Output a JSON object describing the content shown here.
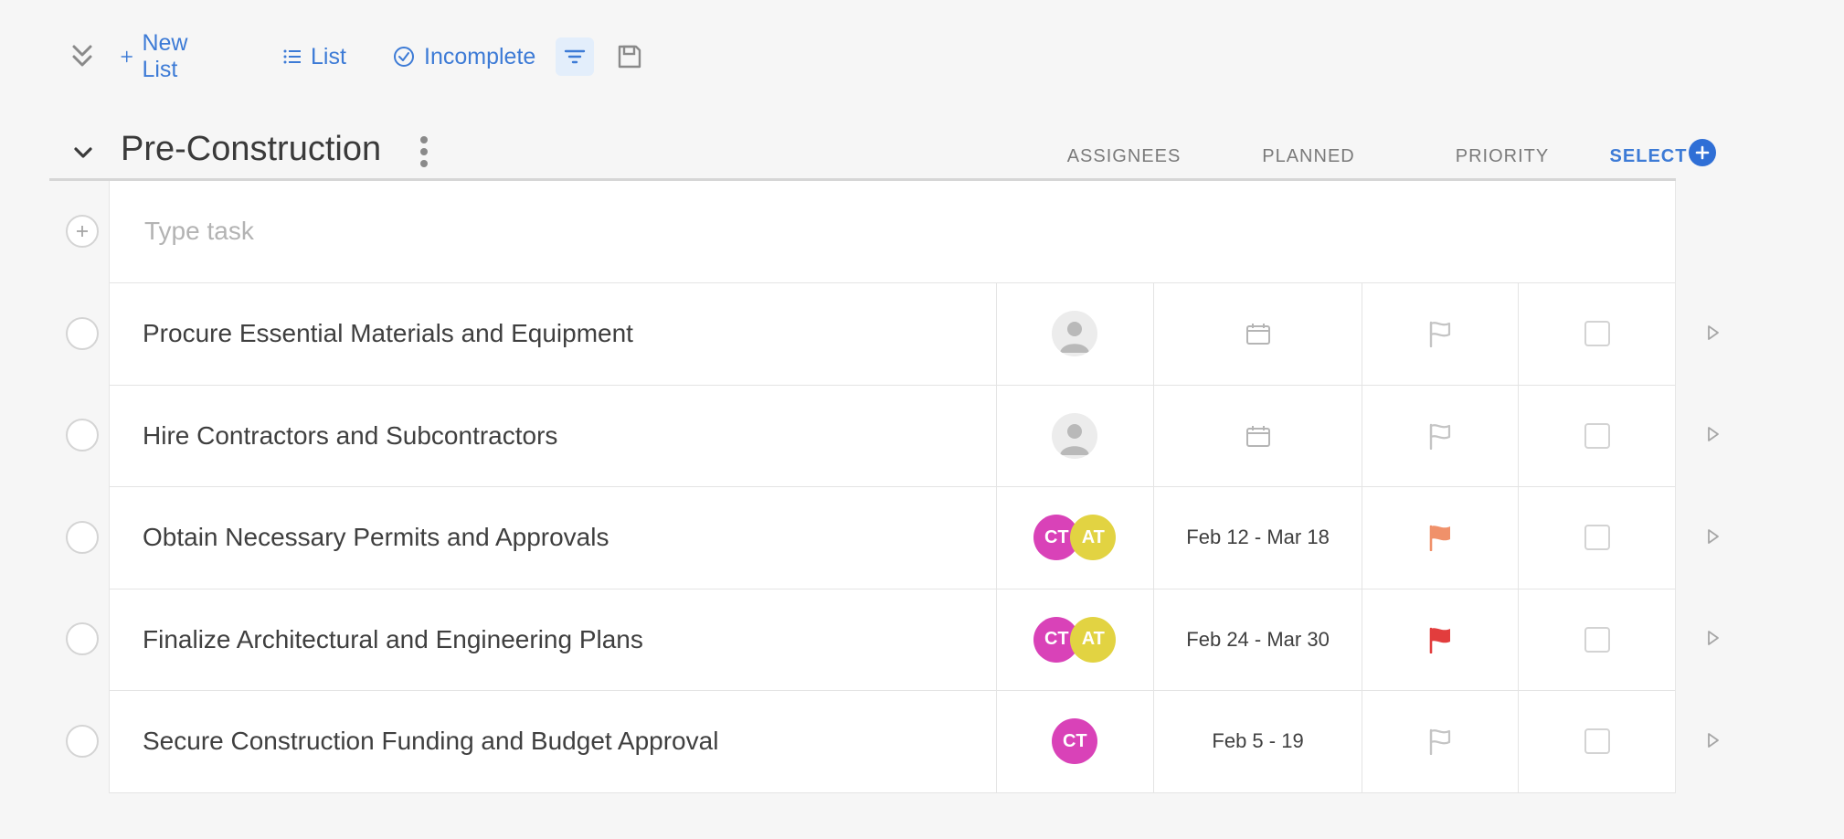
{
  "toolbar": {
    "new_list_label": "New List",
    "list_label": "List",
    "incomplete_label": "Incomplete"
  },
  "section": {
    "title": "Pre-Construction",
    "columns": {
      "assignees": "ASSIGNEES",
      "planned": "PLANNED",
      "priority": "PRIORITY",
      "select": "SELECT"
    }
  },
  "task_input": {
    "placeholder": "Type task"
  },
  "tasks": [
    {
      "name": "Procure Essential Materials and Equipment",
      "assignees": [],
      "planned": "",
      "priority": "none"
    },
    {
      "name": "Hire Contractors and Subcontractors",
      "assignees": [],
      "planned": "",
      "priority": "none"
    },
    {
      "name": "Obtain Necessary Permits and Approvals",
      "assignees": [
        "CT",
        "AT"
      ],
      "planned": "Feb 12 - Mar 18",
      "priority": "medium"
    },
    {
      "name": "Finalize Architectural and Engineering Plans",
      "assignees": [
        "CT",
        "AT"
      ],
      "planned": "Feb 24 - Mar 30",
      "priority": "high"
    },
    {
      "name": "Secure Construction Funding and Budget Approval",
      "assignees": [
        "CT"
      ],
      "planned": "Feb 5 - 19",
      "priority": "none"
    }
  ],
  "colors": {
    "accent": "#3d7bd6",
    "avatar_ct": "#d942b8",
    "avatar_at": "#e2d342",
    "priority_medium": "#f0916a",
    "priority_high": "#e23d3d",
    "priority_none": "#c4c4c4"
  },
  "icons": {
    "collapse": "double-chevron-down-icon",
    "new_list": "plus-icon",
    "list": "list-icon",
    "incomplete": "check-circle-icon",
    "filter": "filter-icon",
    "save": "save-icon",
    "section_toggle": "chevron-down-icon",
    "section_menu": "more-vertical-icon",
    "add_column": "plus-circle-icon",
    "calendar": "calendar-icon",
    "flag": "flag-icon",
    "expand_row": "play-triangle-icon"
  }
}
